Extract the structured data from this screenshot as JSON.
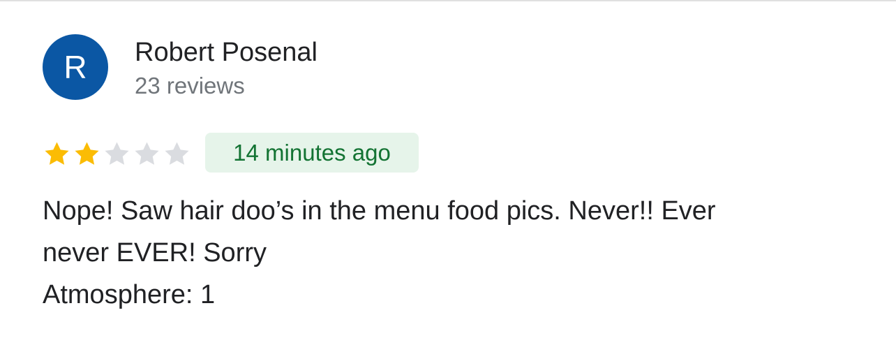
{
  "review": {
    "author": {
      "initial": "R",
      "name": "Robert Posenal",
      "review_count": "23 reviews",
      "avatar_color": "#0b57a4"
    },
    "rating": {
      "value": 2,
      "max": 5,
      "filled_color": "#fbbc04",
      "empty_color": "#dadce0"
    },
    "time_ago": "14 minutes ago",
    "text_lines": [
      "Nope! Saw hair doo’s in the menu food pics. Never!! Ever",
      "never EVER! Sorry"
    ],
    "attributes": [
      {
        "label": "Atmosphere:",
        "value": "1"
      }
    ]
  }
}
